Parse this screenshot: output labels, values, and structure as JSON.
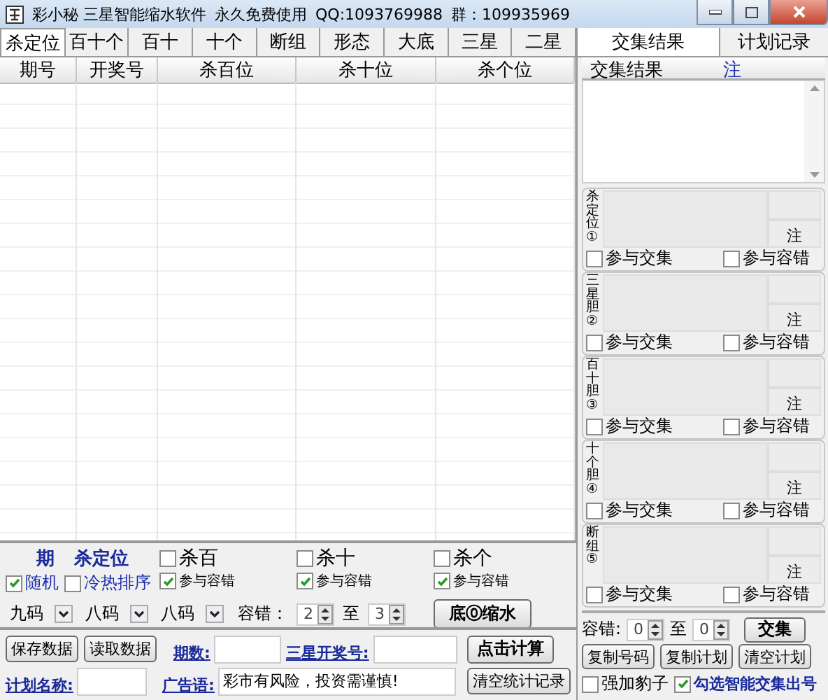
{
  "window": {
    "title": "彩小秘 三星智能缩水软件",
    "notice": "永久免费使用",
    "qq": "QQ:1093769988",
    "group": "群：109935969"
  },
  "tabs": [
    {
      "label": "杀定位",
      "selected": true
    },
    {
      "label": "百十个",
      "selected": false
    },
    {
      "label": "百十",
      "selected": false
    },
    {
      "label": "十个",
      "selected": false
    },
    {
      "label": "断组",
      "selected": false
    },
    {
      "label": "形态",
      "selected": false
    },
    {
      "label": "大底",
      "selected": false
    },
    {
      "label": "三星",
      "selected": false
    },
    {
      "label": "二星",
      "selected": false
    }
  ],
  "right_tabs": [
    {
      "label": "交集结果",
      "selected": true
    },
    {
      "label": "计划记录",
      "selected": false
    }
  ],
  "table": {
    "columns": [
      "期号",
      "开奖号",
      "杀百位",
      "杀十位",
      "杀个位"
    ]
  },
  "options": {
    "period_label": "期",
    "position_label": "杀定位",
    "random": {
      "label": "随机",
      "checked": true
    },
    "hotcold": {
      "label": "冷热排序",
      "checked": false
    },
    "groups": [
      {
        "label": "杀百",
        "checked": false,
        "tolerance": {
          "label": "参与容错",
          "checked": true
        }
      },
      {
        "label": "杀十",
        "checked": false,
        "tolerance": {
          "label": "参与容错",
          "checked": true
        }
      },
      {
        "label": "杀个",
        "checked": false,
        "tolerance": {
          "label": "参与容错",
          "checked": true
        }
      }
    ],
    "selects": [
      "九码",
      "八码",
      "八码"
    ],
    "tolerance_label": "容错：",
    "tolerance_from": "2",
    "to_label": "至",
    "tolerance_to": "3",
    "shrink_button": "底⓪缩水"
  },
  "bottom": {
    "save_button": "保存数据",
    "load_button": "读取数据",
    "periods_label": "期数:",
    "draw_label": "三星开奖号:",
    "calc_button": "点击计算",
    "plan_label": "计划名称:",
    "slogan_label": "广告语:",
    "slogan_value": "彩市有风险，投资需谨慎!",
    "clear_button": "清空统计记录"
  },
  "results": {
    "title": "交集结果",
    "count_label": "注"
  },
  "sections": [
    {
      "label": "杀定位①",
      "count_label": "注",
      "join": {
        "label": "参与交集",
        "checked": false
      },
      "tolerance": {
        "label": "参与容错",
        "checked": false
      }
    },
    {
      "label": "三星胆②",
      "count_label": "注",
      "join": {
        "label": "参与交集",
        "checked": false
      },
      "tolerance": {
        "label": "参与容错",
        "checked": false
      }
    },
    {
      "label": "百十胆③",
      "count_label": "注",
      "join": {
        "label": "参与交集",
        "checked": false
      },
      "tolerance": {
        "label": "参与容错",
        "checked": false
      }
    },
    {
      "label": "十个胆④",
      "count_label": "注",
      "join": {
        "label": "参与交集",
        "checked": false
      },
      "tolerance": {
        "label": "参与容错",
        "checked": false
      }
    },
    {
      "label": "断组⑤",
      "count_label": "注",
      "join": {
        "label": "参与交集",
        "checked": false
      },
      "tolerance": {
        "label": "参与容错",
        "checked": false
      }
    }
  ],
  "right_bottom": {
    "tolerance_label": "容错:",
    "from": "0",
    "to_label": "至",
    "to": "0",
    "intersect_button": "交集",
    "copy_numbers_button": "复制号码",
    "copy_plan_button": "复制计划",
    "clear_plan_button": "清空计划",
    "leopard": {
      "label": "强加豹子",
      "checked": false
    },
    "smart": {
      "label": "勾选智能交集出号",
      "checked": true
    }
  }
}
